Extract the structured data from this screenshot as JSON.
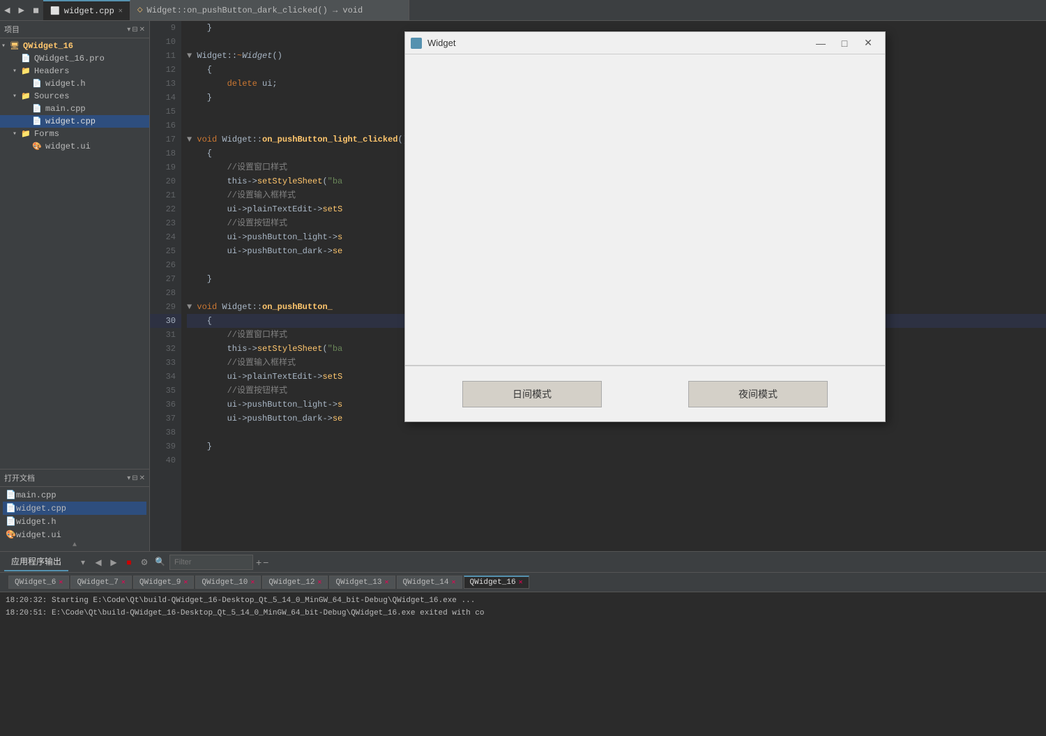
{
  "app": {
    "title": "Qt Creator"
  },
  "toolbar": {
    "nav_back": "◀",
    "nav_fwd": "▶",
    "nav_stop": "◼"
  },
  "tabs": [
    {
      "id": "tab-widget-cpp",
      "label": "widget.cpp",
      "active": true,
      "closable": true
    },
    {
      "id": "tab-signal",
      "label": "Widget::on_pushButton_dark_clicked() → void",
      "active": false
    }
  ],
  "sidebar": {
    "title": "项目",
    "tree": [
      {
        "id": "qwidget16",
        "label": "QWidget_16",
        "level": 0,
        "type": "project",
        "expanded": true
      },
      {
        "id": "qwidget16pro",
        "label": "QWidget_16.pro",
        "level": 1,
        "type": "pro"
      },
      {
        "id": "headers",
        "label": "Headers",
        "level": 1,
        "type": "folder",
        "expanded": true
      },
      {
        "id": "widgeth",
        "label": "widget.h",
        "level": 2,
        "type": "h"
      },
      {
        "id": "sources",
        "label": "Sources",
        "level": 1,
        "type": "folder",
        "expanded": true
      },
      {
        "id": "maincpp",
        "label": "main.cpp",
        "level": 2,
        "type": "cpp"
      },
      {
        "id": "widgetcpp",
        "label": "widget.cpp",
        "level": 2,
        "type": "cpp",
        "selected": true
      },
      {
        "id": "forms",
        "label": "Forms",
        "level": 1,
        "type": "folder",
        "expanded": true
      },
      {
        "id": "widgetui",
        "label": "widget.ui",
        "level": 2,
        "type": "ui"
      }
    ]
  },
  "open_docs": {
    "title": "打开文档",
    "items": [
      {
        "label": "main.cpp"
      },
      {
        "label": "widget.cpp",
        "selected": true
      },
      {
        "label": "widget.h"
      },
      {
        "label": "widget.ui"
      }
    ]
  },
  "code": {
    "lines": [
      {
        "num": 9,
        "content": "    }"
      },
      {
        "num": 10,
        "content": ""
      },
      {
        "num": 11,
        "content": "▼ Widget::~Widget()",
        "has_arrow": true
      },
      {
        "num": 12,
        "content": "    {"
      },
      {
        "num": 13,
        "content": "        delete ui;"
      },
      {
        "num": 14,
        "content": "    }"
      },
      {
        "num": 15,
        "content": ""
      },
      {
        "num": 16,
        "content": ""
      },
      {
        "num": 17,
        "content": "▼ void Widget::on_pushButton_light_clicked()",
        "has_arrow": true
      },
      {
        "num": 18,
        "content": "    {"
      },
      {
        "num": 19,
        "content": "        //设置窗口样式"
      },
      {
        "num": 20,
        "content": "        this->setStyleSheet(\"ba"
      },
      {
        "num": 21,
        "content": "        //设置输入框样式"
      },
      {
        "num": 22,
        "content": "        ui->plainTextEdit->setS"
      },
      {
        "num": 23,
        "content": "        //设置按钮样式"
      },
      {
        "num": 24,
        "content": "        ui->pushButton_light->s"
      },
      {
        "num": 25,
        "content": "        ui->pushButton_dark->se"
      },
      {
        "num": 26,
        "content": ""
      },
      {
        "num": 27,
        "content": "    }"
      },
      {
        "num": 28,
        "content": ""
      },
      {
        "num": 29,
        "content": "▼ void Widget::on_pushButton_",
        "has_arrow": true
      },
      {
        "num": 30,
        "content": "    {",
        "current": true
      },
      {
        "num": 31,
        "content": "        //设置窗口样式"
      },
      {
        "num": 32,
        "content": "        this->setStyleSheet(\"ba"
      },
      {
        "num": 33,
        "content": "        //设置输入框样式"
      },
      {
        "num": 34,
        "content": "        ui->plainTextEdit->setS"
      },
      {
        "num": 35,
        "content": "        //设置按钮样式"
      },
      {
        "num": 36,
        "content": "        ui->pushButton_light->s"
      },
      {
        "num": 37,
        "content": "        ui->pushButton_dark->se"
      },
      {
        "num": 38,
        "content": ""
      },
      {
        "num": 39,
        "content": "    }"
      },
      {
        "num": 40,
        "content": ""
      }
    ]
  },
  "bottom_panel": {
    "tab": "应用程序输出",
    "filter_placeholder": "Filter",
    "output_tabs": [
      {
        "label": "QWidget_6",
        "closable": true
      },
      {
        "label": "QWidget_7",
        "closable": true
      },
      {
        "label": "QWidget_9",
        "closable": true
      },
      {
        "label": "QWidget_10",
        "closable": true
      },
      {
        "label": "QWidget_12",
        "closable": true
      },
      {
        "label": "QWidget_13",
        "closable": true
      },
      {
        "label": "QWidget_14",
        "closable": true
      },
      {
        "label": "QWidget_16",
        "closable": true,
        "active": true
      }
    ],
    "output_lines": [
      "18:20:32: Starting E:\\Code\\Qt\\build-QWidget_16-Desktop_Qt_5_14_0_MinGW_64_bit-Debug\\QWidget_16.exe ...",
      "18:20:51: E:\\Code\\Qt\\build-QWidget_16-Desktop_Qt_5_14_0_MinGW_64_bit-Debug\\QWidget_16.exe exited with co"
    ]
  },
  "widget_window": {
    "title": "Widget",
    "btn_light": "日间模式",
    "btn_dark": "夜间模式",
    "minimize": "—",
    "maximize": "□",
    "close": "✕"
  }
}
